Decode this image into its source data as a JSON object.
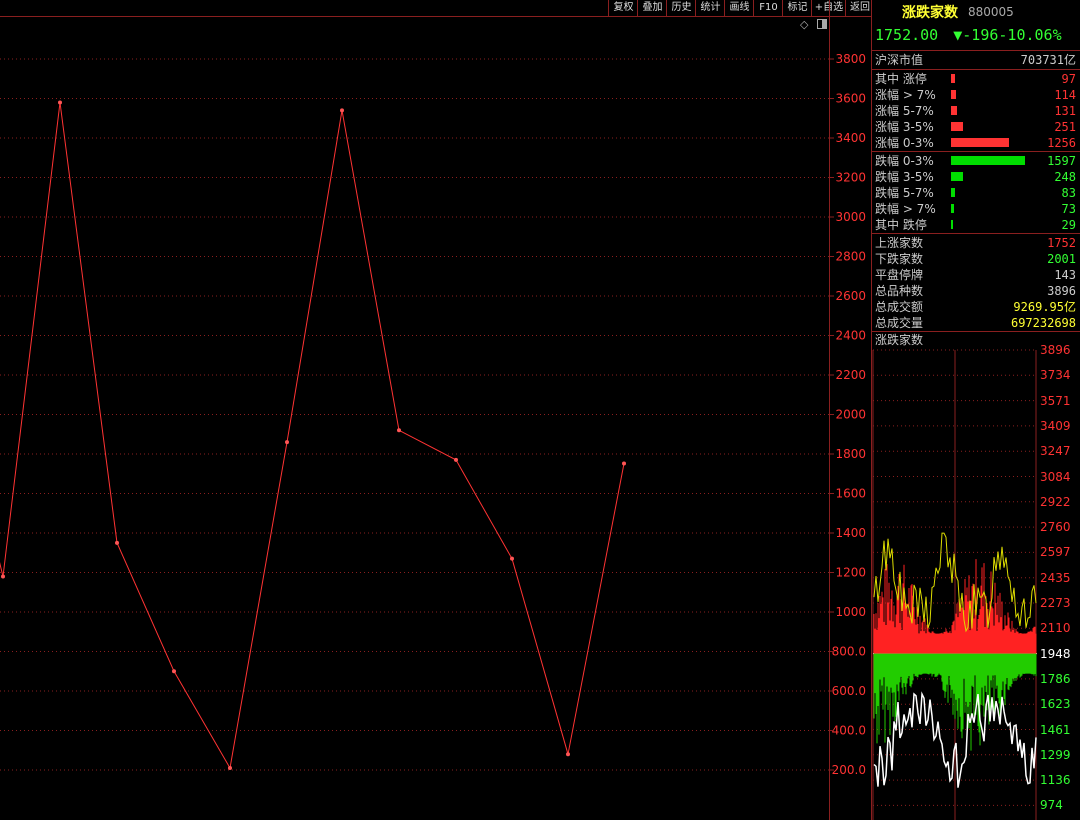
{
  "toolbar": {
    "buttons": [
      "复权",
      "叠加",
      "历史",
      "统计",
      "画线",
      "F10",
      "标记",
      "+自选",
      "返回"
    ]
  },
  "main_chart": {
    "marker_icon": "diamond-icon",
    "panel_icon": "window-toggle-icon",
    "y_ticks": [
      "3800",
      "3600",
      "3400",
      "3200",
      "3000",
      "2800",
      "2600",
      "2400",
      "2200",
      "2000",
      "1800",
      "1600",
      "1400",
      "1200",
      "1000",
      "800.0",
      "600.0",
      "400.0",
      "200.0"
    ],
    "line_color": "#ff3333",
    "grid_color": "#8a1f1f"
  },
  "chart_data": {
    "type": "line",
    "title": "",
    "xlabel": "",
    "ylabel": "",
    "ylim": [
      0,
      3900
    ],
    "x": [
      0,
      1,
      2,
      3,
      4,
      5,
      6,
      7,
      8,
      9,
      10,
      11
    ],
    "series": [
      {
        "values": [
          1180,
          3580,
          1350,
          700,
          210,
          1860,
          3540,
          1920,
          1770,
          1270,
          280,
          1752
        ]
      }
    ]
  },
  "panel": {
    "title": "涨跌家数",
    "code": "880005",
    "price": "1752.00",
    "change_arrow": "▼",
    "change": "-196",
    "change_pct": "-10.06%",
    "market_cap_label": "沪深市值",
    "market_cap_value": "703731亿",
    "up_rows": [
      {
        "label": "其中 涨停",
        "value": "97",
        "bar": 0.06
      },
      {
        "label": "涨幅 > 7%",
        "value": "114",
        "bar": 0.07
      },
      {
        "label": "涨幅 5-7%",
        "value": "131",
        "bar": 0.08
      },
      {
        "label": "涨幅 3-5%",
        "value": "251",
        "bar": 0.16
      },
      {
        "label": "涨幅 0-3%",
        "value": "1256",
        "bar": 0.79
      }
    ],
    "down_rows": [
      {
        "label": "跌幅 0-3%",
        "value": "1597",
        "bar": 1.0
      },
      {
        "label": "跌幅 3-5%",
        "value": "248",
        "bar": 0.16
      },
      {
        "label": "跌幅 5-7%",
        "value": "83",
        "bar": 0.05
      },
      {
        "label": "跌幅 > 7%",
        "value": "73",
        "bar": 0.04
      },
      {
        "label": "其中 跌停",
        "value": "29",
        "bar": 0.02
      }
    ],
    "stats": [
      {
        "label": "上涨家数",
        "value": "1752",
        "color": "#ff3333"
      },
      {
        "label": "下跌家数",
        "value": "2001",
        "color": "#33ff33"
      },
      {
        "label": "平盘停牌",
        "value": "143",
        "color": "#cccccc"
      },
      {
        "label": "总品种数",
        "value": "3896",
        "color": "#cccccc"
      },
      {
        "label": "总成交额",
        "value": "9269.95亿",
        "color": "#ffff33"
      },
      {
        "label": "总成交量",
        "value": "697232698",
        "color": "#ffff33"
      }
    ],
    "mini_title": "涨跌家数",
    "mini_ticks": [
      {
        "label": "3896",
        "color": "#ff3333"
      },
      {
        "label": "3734",
        "color": "#ff3333"
      },
      {
        "label": "3571",
        "color": "#ff3333"
      },
      {
        "label": "3409",
        "color": "#ff3333"
      },
      {
        "label": "3247",
        "color": "#ff3333"
      },
      {
        "label": "3084",
        "color": "#ff3333"
      },
      {
        "label": "2922",
        "color": "#ff3333"
      },
      {
        "label": "2760",
        "color": "#ff3333"
      },
      {
        "label": "2597",
        "color": "#ff3333"
      },
      {
        "label": "2435",
        "color": "#ff3333"
      },
      {
        "label": "2273",
        "color": "#ff3333"
      },
      {
        "label": "2110",
        "color": "#ff3333"
      },
      {
        "label": "1948",
        "color": "#ffffff"
      },
      {
        "label": "1786",
        "color": "#33ff33"
      },
      {
        "label": "1623",
        "color": "#33ff33"
      },
      {
        "label": "1461",
        "color": "#33ff33"
      },
      {
        "label": "1299",
        "color": "#33ff33"
      },
      {
        "label": "1136",
        "color": "#33ff33"
      },
      {
        "label": "974",
        "color": "#33ff33"
      }
    ]
  }
}
